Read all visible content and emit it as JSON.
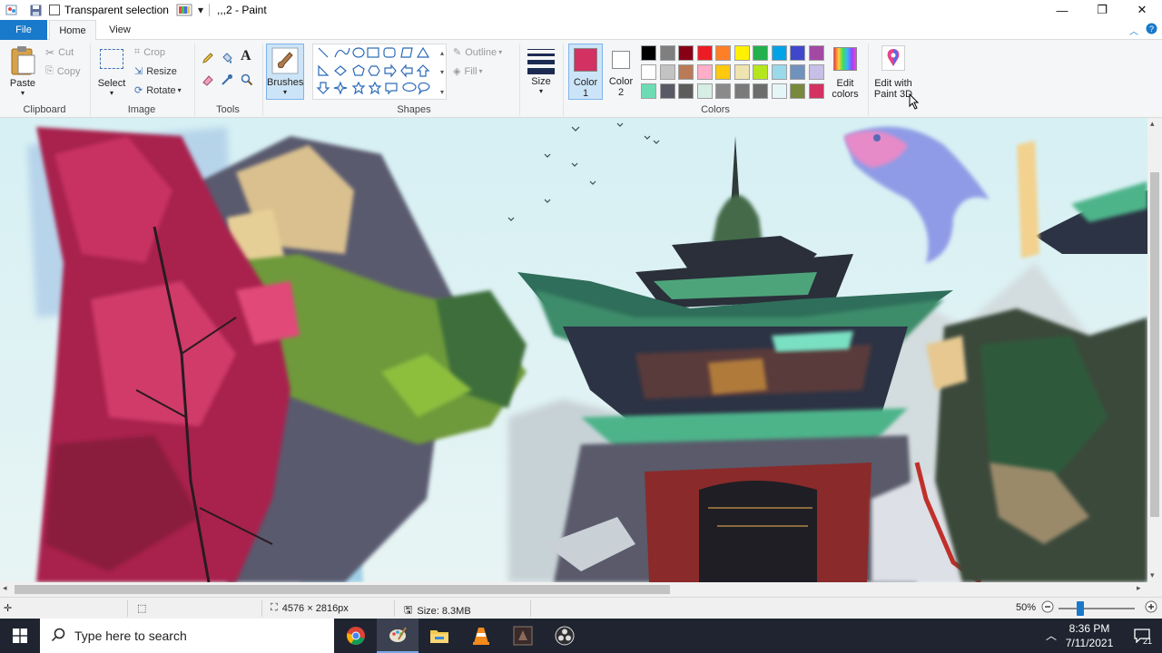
{
  "titlebar": {
    "qa_label": "Transparent selection",
    "title": ",,,2 - Paint",
    "minimize_glyph": "—",
    "restore_glyph": "❐",
    "close_glyph": "✕"
  },
  "tabs": {
    "file": "File",
    "home": "Home",
    "view": "View"
  },
  "clipboard": {
    "paste": "Paste",
    "cut": "Cut",
    "copy": "Copy",
    "group": "Clipboard"
  },
  "image": {
    "select": "Select",
    "crop": "Crop",
    "resize": "Resize",
    "rotate": "Rotate",
    "group": "Image"
  },
  "tools": {
    "group": "Tools"
  },
  "brushes": {
    "label": "Brushes"
  },
  "shapes": {
    "outline": "Outline",
    "fill": "Fill",
    "group": "Shapes"
  },
  "size": {
    "label": "Size"
  },
  "colors": {
    "color1_label1": "Color",
    "color1_label2": "1",
    "color2_label1": "Color",
    "color2_label2": "2",
    "color1_value": "#d23162",
    "color2_value": "#ffffff",
    "edit_colors1": "Edit",
    "edit_colors2": "colors",
    "group": "Colors",
    "palette_row1": [
      "#000000",
      "#7f7f7f",
      "#880015",
      "#ed1c24",
      "#ff7f27",
      "#fff200",
      "#22b14c",
      "#00a2e8",
      "#3f48cc",
      "#a349a4"
    ],
    "palette_row2": [
      "#ffffff",
      "#c3c3c3",
      "#b97a57",
      "#ffaec9",
      "#ffc90e",
      "#efe4b0",
      "#b5e61d",
      "#99d9ea",
      "#7092be",
      "#c8bfe7"
    ],
    "palette_row3": [
      "#6ddcb4",
      "#5a5a66",
      "#5c5c5c",
      "#d6eee4",
      "#8a8a8a",
      "#7a7a7a",
      "#6c6c6c",
      "#e6f6f8",
      "#78883c",
      "#d23162"
    ]
  },
  "paint3d": {
    "line1": "Edit with",
    "line2": "Paint 3D"
  },
  "status": {
    "dimensions": "4576 × 2816px",
    "size": "Size: 8.3MB",
    "zoom": "50%"
  },
  "taskbar": {
    "search_placeholder": "Type here to search",
    "time": "8:36 PM",
    "date": "7/11/2021",
    "notif_count": "21"
  }
}
